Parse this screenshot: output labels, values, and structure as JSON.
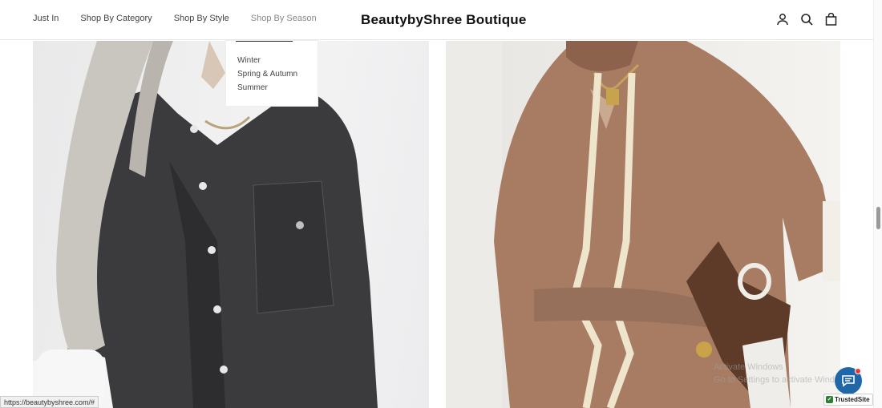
{
  "header": {
    "brand": "BeautybyShree Boutique",
    "nav": [
      {
        "label": "Just In"
      },
      {
        "label": "Shop By Category"
      },
      {
        "label": "Shop By Style"
      },
      {
        "label": "Shop By Season"
      }
    ],
    "icons": [
      "account-icon",
      "search-icon",
      "cart-icon"
    ]
  },
  "dropdown": {
    "items": [
      "Winter",
      "Spring & Autumn",
      "Summer"
    ]
  },
  "products": [
    {
      "icon": "product-image-black-denim-shirt"
    },
    {
      "icon": "product-image-tan-ribbed-hoodie-set"
    }
  ],
  "status_bar": {
    "url": "https://beautybyshree.com/#"
  },
  "widgets": {
    "trusted_site": "TrustedSite",
    "watermark_line1": "Activate Windows",
    "watermark_line2": "Go to Settings to activate Windows."
  },
  "colors": {
    "chat_button": "#2067a8",
    "notification_dot": "#e53935"
  }
}
